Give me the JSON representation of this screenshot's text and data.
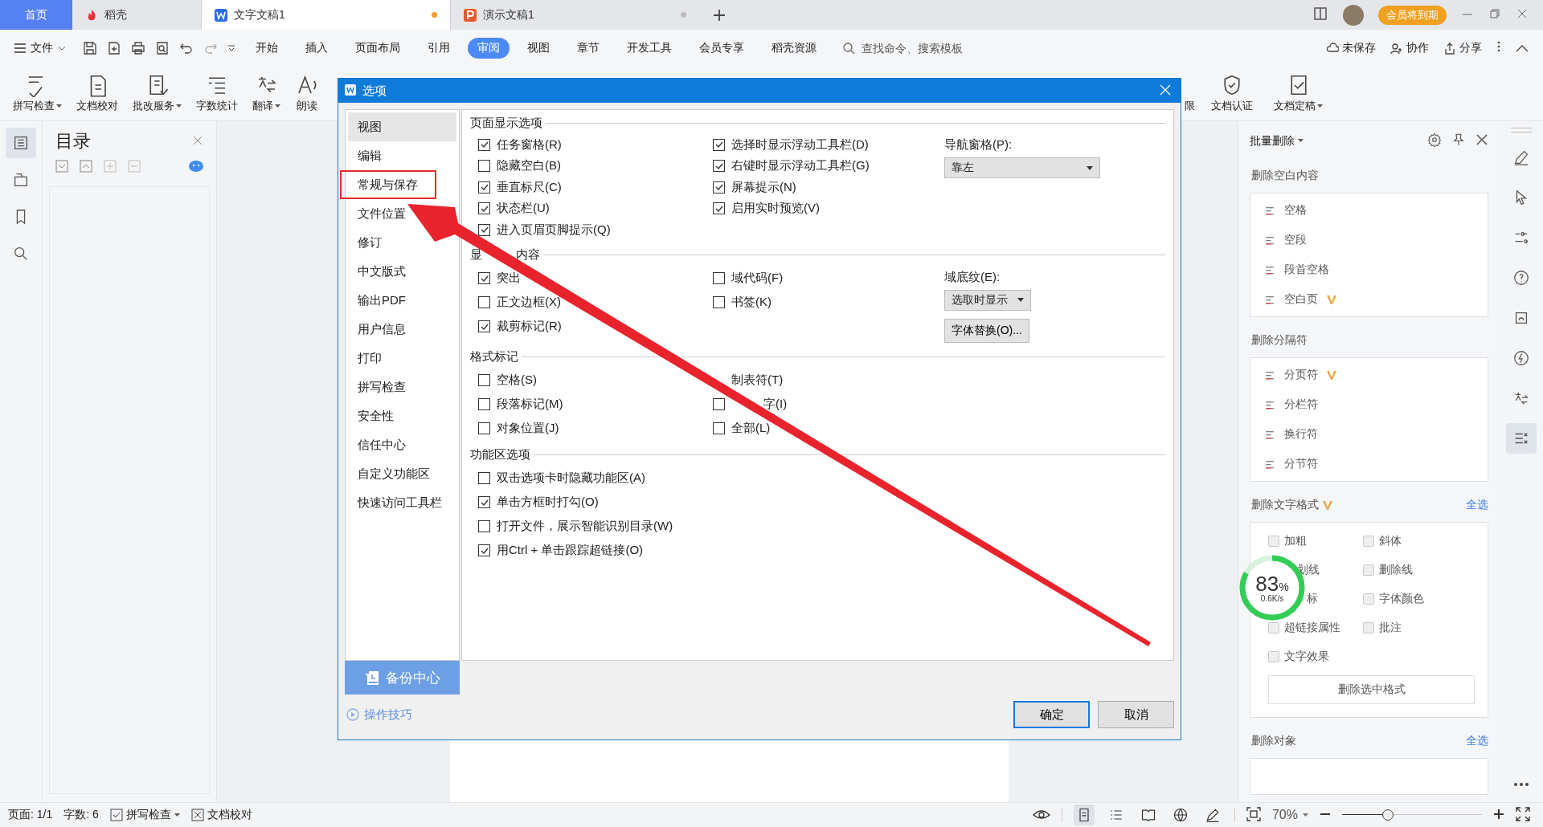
{
  "tabs": [
    {
      "label": "首页",
      "kind": "home",
      "selected": false
    },
    {
      "label": "稻壳",
      "kind": "docer",
      "selected": false
    },
    {
      "label": "文字文稿1",
      "kind": "writer",
      "selected": true,
      "unsaved": true
    },
    {
      "label": "演示文稿1",
      "kind": "slides",
      "selected": false,
      "unsaved": false
    }
  ],
  "member_badge": "会员将到期",
  "menu": {
    "file": "文件",
    "items": [
      {
        "label": "开始",
        "selected": false
      },
      {
        "label": "插入",
        "selected": false
      },
      {
        "label": "页面布局",
        "selected": false
      },
      {
        "label": "引用",
        "selected": false
      },
      {
        "label": "审阅",
        "selected": true
      },
      {
        "label": "视图",
        "selected": false
      },
      {
        "label": "章节",
        "selected": false
      },
      {
        "label": "开发工具",
        "selected": false
      },
      {
        "label": "会员专享",
        "selected": false
      },
      {
        "label": "稻壳资源",
        "selected": false
      }
    ],
    "search": {
      "placeholder": "查找命令、搜索模板"
    },
    "right": [
      "未保存",
      "协作",
      "分享"
    ]
  },
  "ribbon": {
    "left": [
      {
        "label": "拼写检查",
        "dropdown": true
      },
      {
        "label": "文档校对",
        "dropdown": false
      },
      {
        "label": "批改服务",
        "dropdown": true
      },
      {
        "label": "字数统计",
        "dropdown": false
      },
      {
        "label": "翻译",
        "dropdown": true
      },
      {
        "label": "朗读",
        "dropdown": false
      }
    ],
    "right": [
      {
        "label": "限",
        "dropdown": false
      },
      {
        "label": "文档认证",
        "dropdown": false
      },
      {
        "label": "文档定稿",
        "dropdown": true
      }
    ]
  },
  "left_rail": [
    {
      "selected": true
    },
    {
      "selected": false
    },
    {
      "selected": false
    },
    {
      "selected": false
    }
  ],
  "toc": {
    "title": "目录"
  },
  "dialog": {
    "title": "选项",
    "nav": [
      {
        "label": "视图",
        "selected": true,
        "marked": false
      },
      {
        "label": "编辑",
        "selected": false,
        "marked": false
      },
      {
        "label": "常规与保存",
        "selected": false,
        "marked": true
      },
      {
        "label": "文件位置",
        "selected": false,
        "marked": false
      },
      {
        "label": "修订",
        "selected": false,
        "marked": false
      },
      {
        "label": "中文版式",
        "selected": false,
        "marked": false
      },
      {
        "label": "输出PDF",
        "selected": false,
        "marked": false
      },
      {
        "label": "用户信息",
        "selected": false,
        "marked": false
      },
      {
        "label": "打印",
        "selected": false,
        "marked": false
      },
      {
        "label": "拼写检查",
        "selected": false,
        "marked": false
      },
      {
        "label": "安全性",
        "selected": false,
        "marked": false
      },
      {
        "label": "信任中心",
        "selected": false,
        "marked": false
      },
      {
        "label": "自定义功能区",
        "selected": false,
        "marked": false
      },
      {
        "label": "快速访问工具栏",
        "selected": false,
        "marked": false
      }
    ],
    "backup": "备份中心",
    "tips": "操作技巧",
    "sections": [
      {
        "title": "页面显示选项",
        "columns": [
          [
            {
              "label": "任务窗格(R)",
              "checked": true
            },
            {
              "label": "隐藏空白(B)",
              "checked": false
            },
            {
              "label": "垂直标尺(C)",
              "checked": true
            },
            {
              "label": "状态栏(U)",
              "checked": true
            },
            {
              "label": "进入页眉页脚提示(Q)",
              "checked": true
            }
          ],
          [
            {
              "label": "选择时显示浮动工具栏(D)",
              "checked": true
            },
            {
              "label": "右键时显示浮动工具栏(G)",
              "checked": true
            },
            {
              "label": "屏幕提示(N)",
              "checked": true
            },
            {
              "label": "启用实时预览(V)",
              "checked": true
            }
          ]
        ],
        "extras": [
          {
            "kind": "label",
            "text": "导航窗格(P):"
          },
          {
            "kind": "select",
            "text": "靠左"
          }
        ]
      },
      {
        "title": "显",
        "title_2": "内容",
        "columns": [
          [
            {
              "label": "突出",
              "checked": true
            },
            {
              "label": "正文边框(X)",
              "checked": false
            },
            {
              "label": "裁剪标记(R)",
              "checked": true
            }
          ],
          [
            {
              "label": "域代码(F)",
              "checked": false
            },
            {
              "label": "书签(K)",
              "checked": false
            }
          ]
        ],
        "extras": [
          {
            "kind": "label",
            "text": "域底纹(E):"
          },
          {
            "kind": "select",
            "text": "选取时显示"
          },
          {
            "kind": "button",
            "text": "字体替换(O)..."
          }
        ]
      },
      {
        "title": "格式标记",
        "columns": [
          [
            {
              "label": "空格(S)",
              "checked": false
            },
            {
              "label": "段落标记(M)",
              "checked": false
            },
            {
              "label": "对象位置(J)",
              "checked": false
            }
          ],
          [
            {
              "label": "制表符(T)"
            },
            {
              "label": "字(I)",
              "checked": false
            },
            {
              "label": "全部(L)",
              "checked": false
            }
          ]
        ]
      },
      {
        "title": "功能区选项",
        "columns": [
          [
            {
              "label": "双击选项卡时隐藏功能区(A)",
              "checked": false
            },
            {
              "label": "单击方框时打勾(O)",
              "checked": true
            },
            {
              "label": "打开文件，展示智能识别目录(W)",
              "checked": false
            },
            {
              "label": "用Ctrl + 单击跟踪超链接(O)",
              "checked": true
            }
          ]
        ]
      }
    ],
    "buttons": [
      {
        "label": "确定",
        "default": true
      },
      {
        "label": "取消",
        "default": false
      }
    ]
  },
  "panel": {
    "title": "批量删除",
    "groups": [
      {
        "title": "删除空白内容",
        "items": [
          {
            "label": "空格",
            "vip": false
          },
          {
            "label": "空段",
            "vip": false
          },
          {
            "label": "段首空格",
            "vip": false
          },
          {
            "label": "空白页",
            "vip": true
          }
        ]
      },
      {
        "title": "删除分隔符",
        "items": [
          {
            "label": "分页符",
            "vip": true
          },
          {
            "label": "分栏符",
            "vip": false
          },
          {
            "label": "换行符",
            "vip": false
          },
          {
            "label": "分节符",
            "vip": false
          }
        ]
      }
    ],
    "format": {
      "title": "删除文字格式",
      "vip": true,
      "select_all": "全选",
      "options": [
        {
          "label": "加粗",
          "checked": false
        },
        {
          "label": "斜体",
          "checked": false
        },
        {
          "label": "划线"
        },
        {
          "label": "删除线",
          "checked": false
        },
        {
          "label": "标"
        },
        {
          "label": "字体颜色",
          "checked": false
        },
        {
          "label": "超链接属性",
          "checked": false
        },
        {
          "label": "批注",
          "checked": false
        },
        {
          "label": "文字效果",
          "checked": false
        }
      ],
      "button": "删除选中格式"
    },
    "objects": {
      "title": "删除对象",
      "select_all": "全选"
    }
  },
  "right_rail": [
    {
      "selected": false
    },
    {
      "selected": false
    },
    {
      "selected": false
    },
    {
      "selected": false
    },
    {
      "selected": false
    },
    {
      "selected": false
    },
    {
      "selected": false
    },
    {
      "selected": true
    }
  ],
  "speed_widget": {
    "percent": "83",
    "unit": "%",
    "rate": "0.6K/s",
    "level": 0.83
  },
  "status": {
    "page": "页面: 1/1",
    "words": "字数: 6",
    "spell": "拼写检查",
    "proof": "文档校对",
    "views": [
      {
        "selected": true
      },
      {
        "selected": false
      },
      {
        "selected": false
      },
      {
        "selected": false
      },
      {
        "selected": false
      }
    ],
    "zoom": "70%",
    "zoom_slider": {
      "level": 0.33
    }
  }
}
